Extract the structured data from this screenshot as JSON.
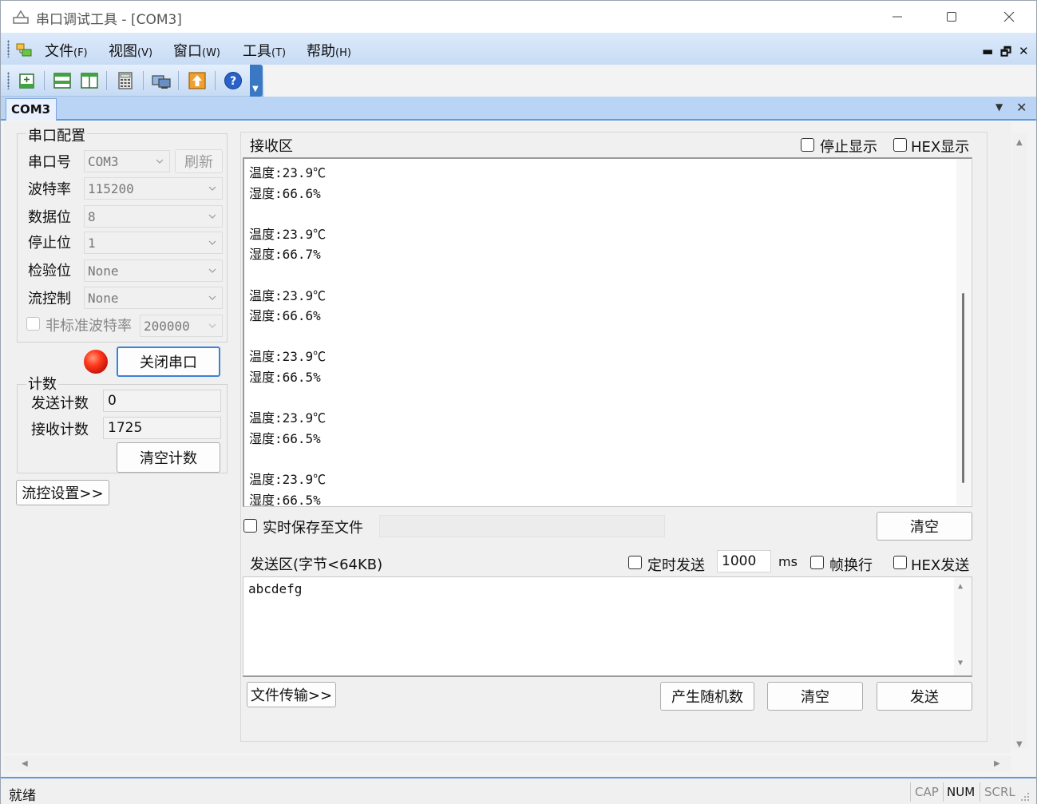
{
  "window": {
    "title": "串口调试工具 - [COM3]"
  },
  "menubar": {
    "items": [
      {
        "label": "文件",
        "accel": "(F)"
      },
      {
        "label": "视图",
        "accel": "(V)"
      },
      {
        "label": "窗口",
        "accel": "(W)"
      },
      {
        "label": "工具",
        "accel": "(T)"
      },
      {
        "label": "帮助",
        "accel": "(H)"
      }
    ],
    "mdi_min": "▬",
    "mdi_restore": "🗗",
    "mdi_close": "✕"
  },
  "toolbar": {
    "buttons": [
      "new-icon",
      "split-horizontal-icon",
      "split-vertical-icon",
      "calculator-icon",
      "network-icon",
      "upload-icon",
      "help-icon"
    ]
  },
  "tabs": [
    {
      "label": "COM3"
    }
  ],
  "serial_config": {
    "group_label": "串口配置",
    "port_label": "串口号",
    "port_value": "COM3",
    "refresh_label": "刷新",
    "baud_label": "波特率",
    "baud_value": "115200",
    "databits_label": "数据位",
    "databits_value": "8",
    "stopbits_label": "停止位",
    "stopbits_value": "1",
    "parity_label": "检验位",
    "parity_value": "None",
    "flow_label": "流控制",
    "flow_value": "None",
    "nonstd_label": "非标准波特率",
    "nonstd_value": "200000",
    "close_port_label": "关闭串口"
  },
  "counter": {
    "group_label": "计数",
    "send_label": "发送计数",
    "send_value": "0",
    "recv_label": "接收计数",
    "recv_value": "1725",
    "clear_label": "清空计数"
  },
  "flow_settings_label": "流控设置>>",
  "receive": {
    "title": "接收区",
    "stop_display_label": "停止显示",
    "hex_display_label": "HEX显示",
    "lines": [
      "温度:23.9℃",
      "湿度:66.6%",
      "",
      "温度:23.9℃",
      "湿度:66.7%",
      "",
      "温度:23.9℃",
      "湿度:66.6%",
      "",
      "温度:23.9℃",
      "湿度:66.5%",
      "",
      "温度:23.9℃",
      "湿度:66.5%",
      "",
      "温度:23.9℃",
      "湿度:66.5%"
    ],
    "save_file_label": "实时保存至文件",
    "clear_label": "清空"
  },
  "send": {
    "title": "发送区(字节<64KB)",
    "timed_send_label": "定时发送",
    "interval_value": "1000",
    "interval_unit": "ms",
    "newline_label": "帧换行",
    "hex_send_label": "HEX发送",
    "content": "abcdefg",
    "file_transfer_label": "文件传输>>",
    "random_label": "产生随机数",
    "clear_label": "清空",
    "send_label": "发送"
  },
  "statusbar": {
    "text": "就绪",
    "cap": "CAP",
    "num": "NUM",
    "scrl": "SCRL"
  }
}
